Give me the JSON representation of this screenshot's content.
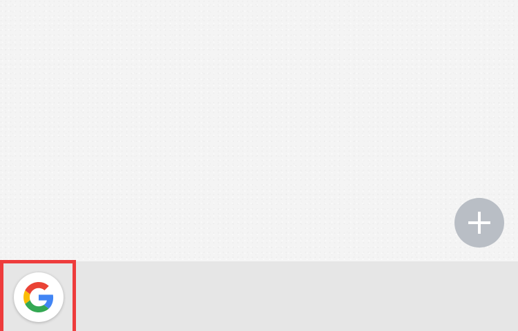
{
  "canvas": {
    "background_color": "#f4f4f4"
  },
  "add_button": {
    "icon": "plus-icon",
    "color": "#b9bec5"
  },
  "dock": {
    "background_color": "#e6e6e6",
    "highlight_color": "#ee3c3c",
    "google_button": {
      "icon": "google-g-icon",
      "colors": {
        "blue": "#4285F4",
        "red": "#EA4335",
        "yellow": "#FBBC05",
        "green": "#34A853"
      }
    }
  }
}
